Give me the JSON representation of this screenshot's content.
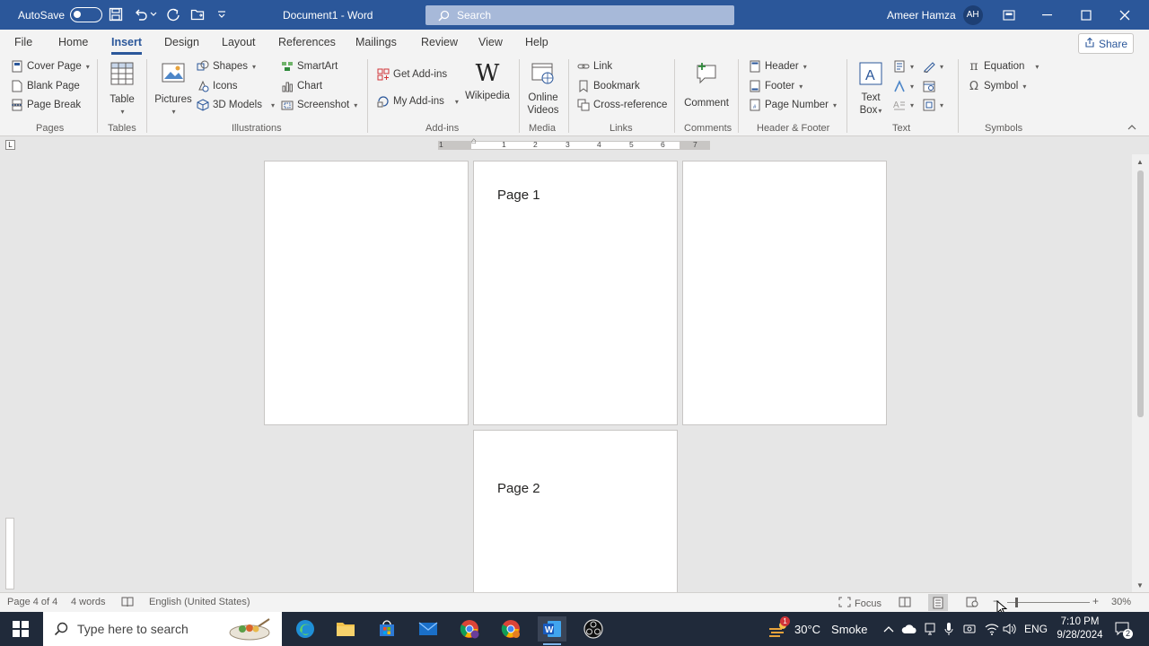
{
  "titlebar": {
    "autosave_label": "AutoSave",
    "autosave_state": "Off",
    "document_title": "Document1  -  Word",
    "search_placeholder": "Search",
    "user_name": "Ameer Hamza",
    "user_initials": "AH"
  },
  "menu": {
    "tabs": [
      "File",
      "Home",
      "Insert",
      "Design",
      "Layout",
      "References",
      "Mailings",
      "Review",
      "View",
      "Help"
    ],
    "active_tab": "Insert",
    "share_label": "Share"
  },
  "ribbon": {
    "pages": {
      "cover_page": "Cover Page",
      "blank_page": "Blank Page",
      "page_break": "Page Break",
      "label": "Pages"
    },
    "tables": {
      "table": "Table",
      "label": "Tables"
    },
    "illustrations": {
      "pictures": "Pictures",
      "shapes": "Shapes",
      "icons": "Icons",
      "models": "3D Models",
      "smartart": "SmartArt",
      "chart": "Chart",
      "screenshot": "Screenshot",
      "label": "Illustrations"
    },
    "addins": {
      "get": "Get Add-ins",
      "my": "My Add-ins",
      "wikipedia": "Wikipedia",
      "label": "Add-ins"
    },
    "media": {
      "online_videos_1": "Online",
      "online_videos_2": "Videos",
      "label": "Media"
    },
    "links": {
      "link": "Link",
      "bookmark": "Bookmark",
      "cross_reference": "Cross-reference",
      "label": "Links"
    },
    "comments": {
      "comment": "Comment",
      "label": "Comments"
    },
    "header_footer": {
      "header": "Header",
      "footer": "Footer",
      "page_number": "Page Number",
      "label": "Header & Footer"
    },
    "text": {
      "text_box_1": "Text",
      "text_box_2": "Box",
      "label": "Text"
    },
    "symbols": {
      "equation": "Equation",
      "symbol": "Symbol",
      "label": "Symbols"
    }
  },
  "ruler": {
    "numbers": [
      "1",
      "1",
      "1",
      "2",
      "3",
      "4",
      "5",
      "6",
      "7"
    ]
  },
  "document": {
    "page1_text": "Page 1",
    "page2_text": "Page 2"
  },
  "statusbar": {
    "page_info": "Page 4 of 4",
    "word_count": "4 words",
    "language": "English (United States)",
    "focus": "Focus",
    "zoom": "30%"
  },
  "taskbar": {
    "search_placeholder": "Type here to search",
    "weather_temp": "30°C",
    "weather_desc": "Smoke",
    "weather_badge": "1",
    "language": "ENG",
    "time": "7:10 PM",
    "date": "9/28/2024",
    "notifications": "2"
  },
  "colors": {
    "word_blue": "#2b579a",
    "taskbar": "#202a3a"
  }
}
